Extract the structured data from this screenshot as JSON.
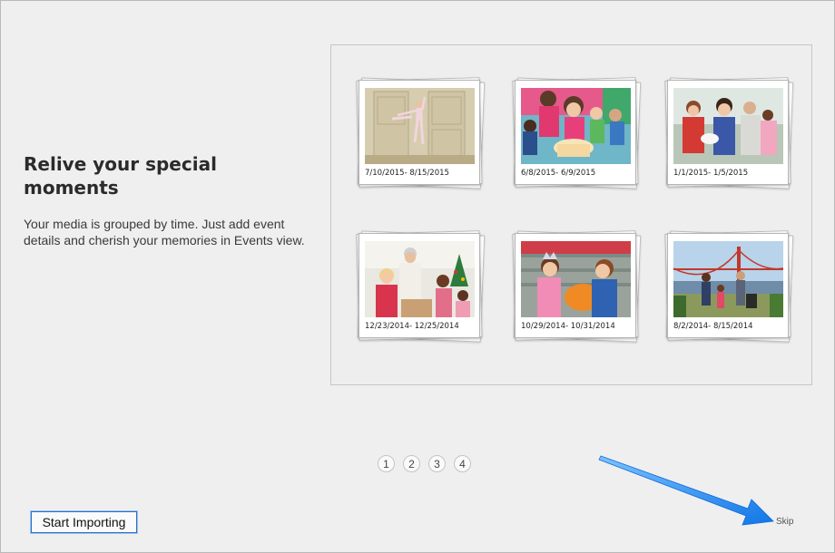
{
  "intro": {
    "heading": "Relive your special moments",
    "description": "Your media is grouped by time. Just add event details and cherish your memories in Events view."
  },
  "events": [
    {
      "date": "7/10/2015- 8/15/2015",
      "photo": "ballet-dancer"
    },
    {
      "date": "6/8/2015- 6/9/2015",
      "photo": "birthday-party"
    },
    {
      "date": "1/1/2015- 1/5/2015",
      "photo": "family-portrait"
    },
    {
      "date": "12/23/2014- 12/25/2014",
      "photo": "christmas-family"
    },
    {
      "date": "10/29/2014- 10/31/2014",
      "photo": "pumpkin-kids"
    },
    {
      "date": "8/2/2014- 8/15/2014",
      "photo": "golden-gate-family"
    }
  ],
  "pager": {
    "pages": [
      "1",
      "2",
      "3",
      "4"
    ]
  },
  "buttons": {
    "start_importing": "Start Importing",
    "skip": "Skip"
  },
  "colors": {
    "accent": "#2f6fc1",
    "arrow": "#1f8ff2"
  }
}
